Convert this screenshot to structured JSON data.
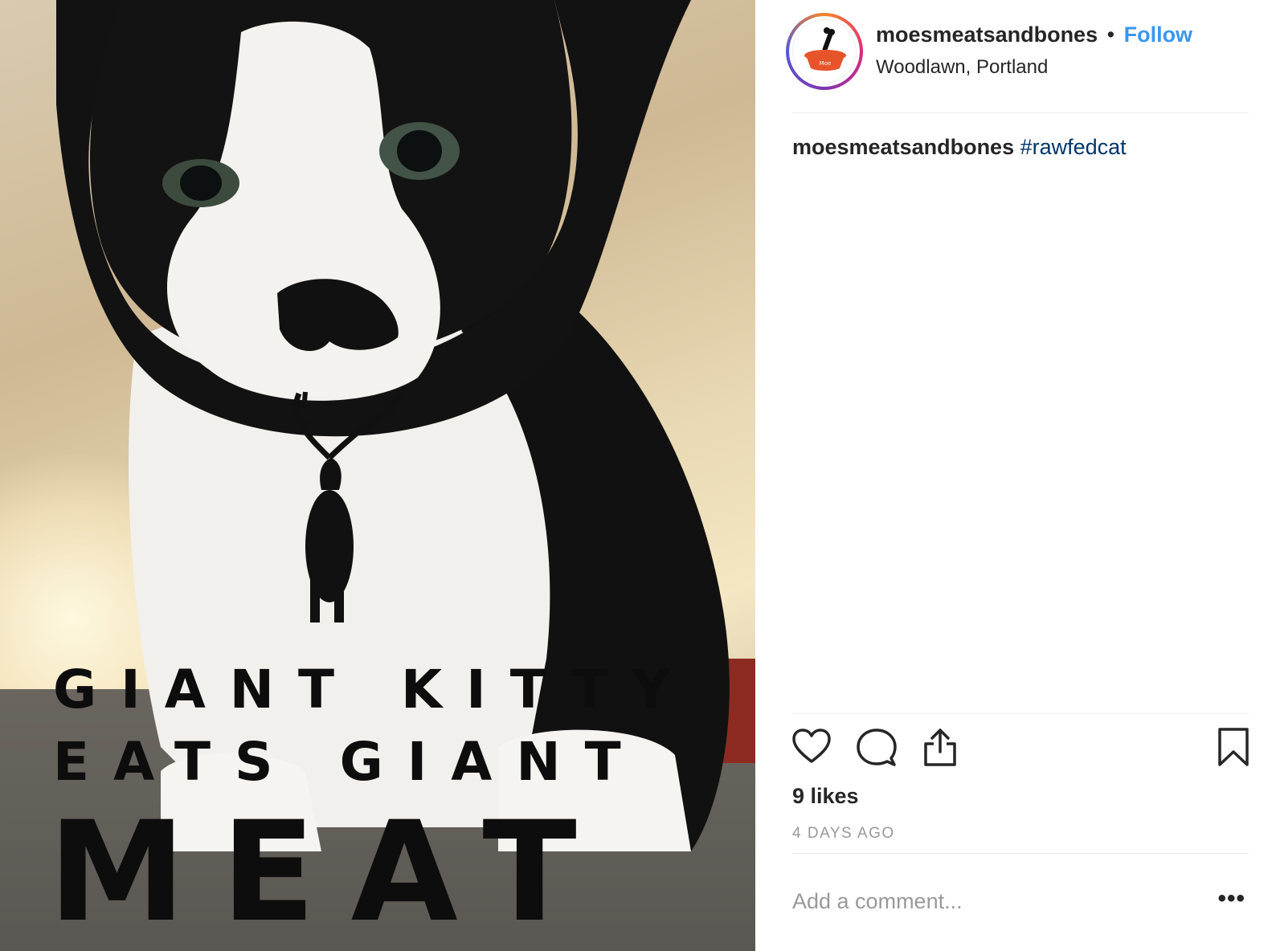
{
  "post": {
    "image_alt": "Black and white cat photo",
    "overlay": {
      "line1": "GIANT KITTY",
      "line2": "EATS GIANT",
      "line3": "MEAT"
    }
  },
  "header": {
    "username": "moesmeatsandbones",
    "separator": "•",
    "follow_label": "Follow",
    "location": "Woodlawn, Portland",
    "avatar_text": "Moe"
  },
  "caption": {
    "username": "moesmeatsandbones",
    "hashtag": "#rawfedcat"
  },
  "actions": {
    "like_icon": "heart-icon",
    "comment_icon": "comment-icon",
    "share_icon": "share-icon",
    "save_icon": "bookmark-icon"
  },
  "stats": {
    "likes": "9 likes",
    "timestamp": "4 DAYS AGO"
  },
  "comment": {
    "placeholder": "Add a comment...",
    "more_label": "•••"
  },
  "colors": {
    "link_blue": "#3897f0",
    "hashtag_blue": "#003569",
    "text": "#262626",
    "muted": "#999999",
    "divider": "#efefef"
  }
}
